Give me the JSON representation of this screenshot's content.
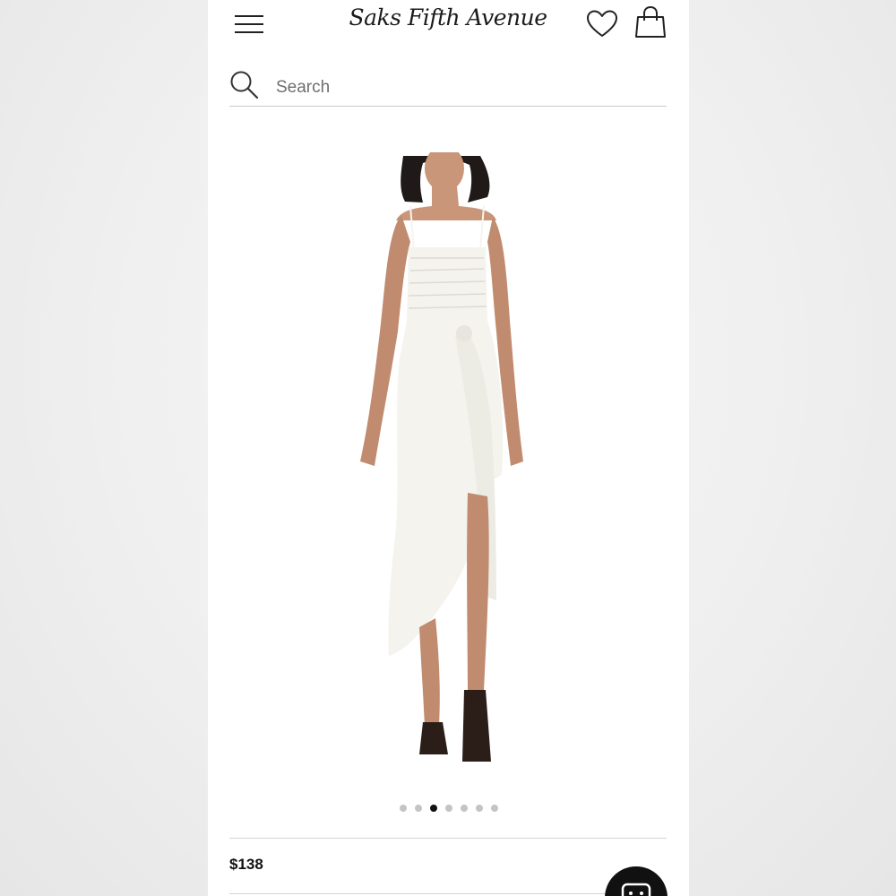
{
  "header": {
    "logo_text": "Saks Fifth Avenue",
    "menu_icon": "hamburger-menu-icon",
    "wishlist_icon": "heart-icon",
    "bag_icon": "shopping-bag-icon"
  },
  "search": {
    "placeholder": "Search",
    "value": "",
    "icon": "search-icon"
  },
  "product": {
    "image_alt": "White ruched side-tie midi dress",
    "price": "$138",
    "carousel": {
      "total": 7,
      "active_index": 2
    }
  },
  "chat": {
    "icon": "chat-icon"
  },
  "colors": {
    "dot_active": "#111111",
    "dot_inactive": "#c4c4c4",
    "divider": "#d4d4d4"
  }
}
